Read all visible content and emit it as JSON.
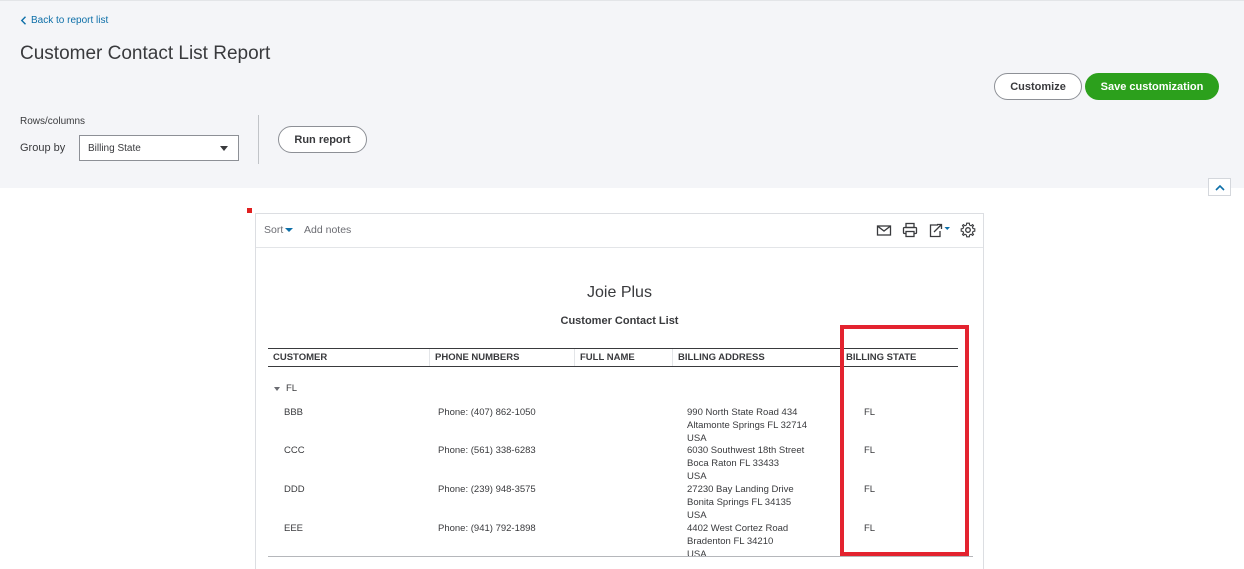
{
  "header": {
    "back_link": "Back to report list",
    "title": "Customer Contact List Report",
    "customize_label": "Customize",
    "save_label": "Save customization"
  },
  "controls": {
    "rows_columns_label": "Rows/columns",
    "group_by_label": "Group by",
    "group_by_value": "Billing State",
    "run_report_label": "Run report"
  },
  "toolbar": {
    "sort_label": "Sort",
    "add_notes_label": "Add notes",
    "icons": [
      "mail-icon",
      "print-icon",
      "export-icon",
      "gear-icon"
    ]
  },
  "report": {
    "company": "Joie Plus",
    "name": "Customer Contact List",
    "columns": [
      "CUSTOMER",
      "PHONE NUMBERS",
      "FULL NAME",
      "BILLING ADDRESS",
      "BILLING STATE"
    ],
    "group_label": "FL",
    "rows": [
      {
        "customer": "BBB",
        "phone": "Phone: (407) 862-1050",
        "full_name": "",
        "address": [
          "990 North State Road 434",
          "Altamonte Springs FL 32714",
          "USA"
        ],
        "state": "FL"
      },
      {
        "customer": "CCC",
        "phone": "Phone: (561) 338-6283",
        "full_name": "",
        "address": [
          "6030 Southwest 18th Street",
          "Boca Raton FL 33433",
          "USA"
        ],
        "state": "FL"
      },
      {
        "customer": "DDD",
        "phone": "Phone: (239) 948-3575",
        "full_name": "",
        "address": [
          "27230 Bay Landing Drive",
          "Bonita Springs FL 34135",
          "USA"
        ],
        "state": "FL"
      },
      {
        "customer": "EEE",
        "phone": "Phone: (941) 792-1898",
        "full_name": "",
        "address": [
          "4402 West Cortez Road",
          "Bradenton FL 34210",
          "USA"
        ],
        "state": "FL"
      }
    ]
  },
  "colors": {
    "accent_green": "#2ca01c",
    "link_blue": "#0d6fa8",
    "highlight_red": "#e3232f"
  }
}
